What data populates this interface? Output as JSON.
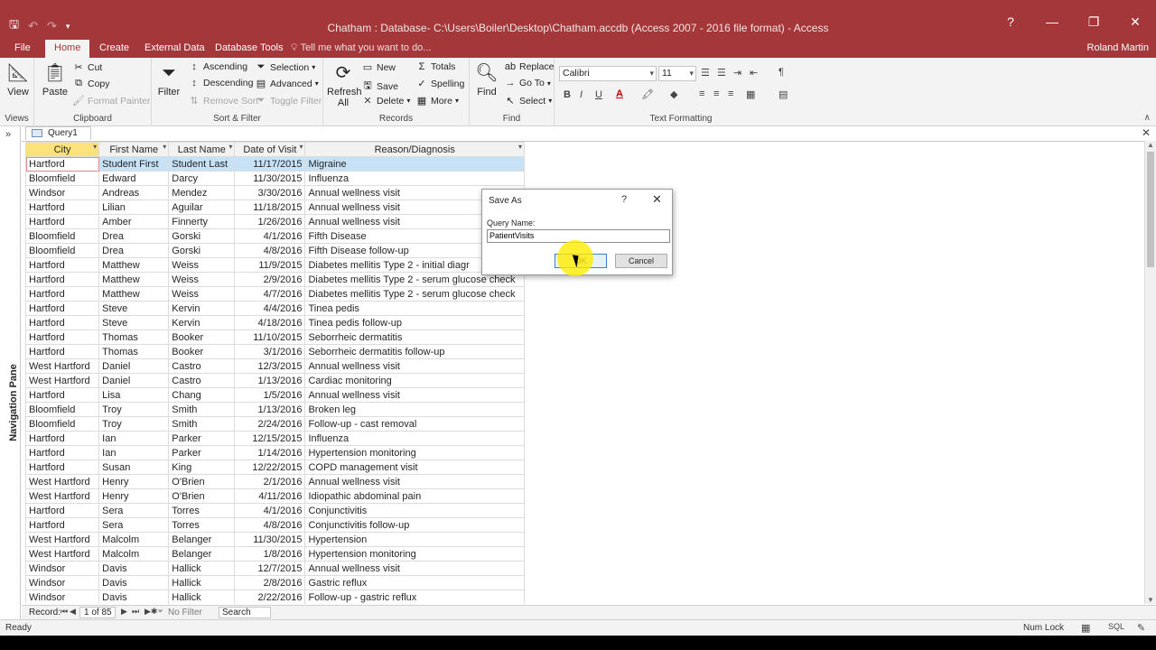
{
  "window": {
    "title": "Chatham : Database- C:\\Users\\Boiler\\Desktop\\Chatham.accdb (Access 2007 - 2016 file format) - Access",
    "user": "Roland Martin",
    "tell_me": "Tell me what you want to do..."
  },
  "tabs": [
    "File",
    "Home",
    "Create",
    "External Data",
    "Database Tools"
  ],
  "ribbon": {
    "views": {
      "view": "View",
      "label": "Views"
    },
    "clipboard": {
      "paste": "Paste",
      "cut": "Cut",
      "copy": "Copy",
      "format_painter": "Format Painter",
      "label": "Clipboard"
    },
    "sort_filter": {
      "filter": "Filter",
      "ascending": "Ascending",
      "descending": "Descending",
      "remove_sort": "Remove Sort",
      "selection": "Selection",
      "advanced": "Advanced",
      "toggle_filter": "Toggle Filter",
      "label": "Sort & Filter"
    },
    "records": {
      "refresh": "Refresh",
      "refresh2": "All",
      "new": "New",
      "save": "Save",
      "delete": "Delete",
      "totals": "Totals",
      "spelling": "Spelling",
      "more": "More",
      "label": "Records"
    },
    "find": {
      "find": "Find",
      "replace": "Replace",
      "goto": "Go To",
      "select": "Select",
      "label": "Find"
    },
    "text_formatting": {
      "font": "Calibri",
      "size": "11",
      "bold": "B",
      "italic": "I",
      "underline": "U",
      "label": "Text Formatting"
    }
  },
  "navigation_pane": {
    "label": "Navigation Pane"
  },
  "document_tab": "Query1",
  "grid": {
    "columns": [
      "City",
      "First Name",
      "Last Name",
      "Date of Visit",
      "Reason/Diagnosis"
    ],
    "rows": [
      [
        "Hartford",
        "Student First",
        "Student Last",
        "11/17/2015",
        "Migraine"
      ],
      [
        "Bloomfield",
        "Edward",
        "Darcy",
        "11/30/2015",
        "Influenza"
      ],
      [
        "Windsor",
        "Andreas",
        "Mendez",
        "3/30/2016",
        "Annual wellness visit"
      ],
      [
        "Hartford",
        "Lilian",
        "Aguilar",
        "11/18/2015",
        "Annual wellness visit"
      ],
      [
        "Hartford",
        "Amber",
        "Finnerty",
        "1/26/2016",
        "Annual wellness visit"
      ],
      [
        "Bloomfield",
        "Drea",
        "Gorski",
        "4/1/2016",
        "Fifth Disease"
      ],
      [
        "Bloomfield",
        "Drea",
        "Gorski",
        "4/8/2016",
        "Fifth Disease follow-up"
      ],
      [
        "Hartford",
        "Matthew",
        "Weiss",
        "11/9/2015",
        "Diabetes mellitis Type 2 - initial diagr"
      ],
      [
        "Hartford",
        "Matthew",
        "Weiss",
        "2/9/2016",
        "Diabetes mellitis Type 2 - serum glucose check"
      ],
      [
        "Hartford",
        "Matthew",
        "Weiss",
        "4/7/2016",
        "Diabetes mellitis Type 2 - serum glucose check"
      ],
      [
        "Hartford",
        "Steve",
        "Kervin",
        "4/4/2016",
        "Tinea pedis"
      ],
      [
        "Hartford",
        "Steve",
        "Kervin",
        "4/18/2016",
        "Tinea pedis follow-up"
      ],
      [
        "Hartford",
        "Thomas",
        "Booker",
        "11/10/2015",
        "Seborrheic dermatitis"
      ],
      [
        "Hartford",
        "Thomas",
        "Booker",
        "3/1/2016",
        "Seborrheic dermatitis follow-up"
      ],
      [
        "West Hartford",
        "Daniel",
        "Castro",
        "12/3/2015",
        "Annual wellness visit"
      ],
      [
        "West Hartford",
        "Daniel",
        "Castro",
        "1/13/2016",
        "Cardiac monitoring"
      ],
      [
        "Hartford",
        "Lisa",
        "Chang",
        "1/5/2016",
        "Annual wellness visit"
      ],
      [
        "Bloomfield",
        "Troy",
        "Smith",
        "1/13/2016",
        "Broken leg"
      ],
      [
        "Bloomfield",
        "Troy",
        "Smith",
        "2/24/2016",
        "Follow-up - cast removal"
      ],
      [
        "Hartford",
        "Ian",
        "Parker",
        "12/15/2015",
        "Influenza"
      ],
      [
        "Hartford",
        "Ian",
        "Parker",
        "1/14/2016",
        "Hypertension monitoring"
      ],
      [
        "Hartford",
        "Susan",
        "King",
        "12/22/2015",
        "COPD management visit"
      ],
      [
        "West Hartford",
        "Henry",
        "O'Brien",
        "2/1/2016",
        "Annual wellness visit"
      ],
      [
        "West Hartford",
        "Henry",
        "O'Brien",
        "4/11/2016",
        "Idiopathic abdominal pain"
      ],
      [
        "Hartford",
        "Sera",
        "Torres",
        "4/1/2016",
        "Conjunctivitis"
      ],
      [
        "Hartford",
        "Sera",
        "Torres",
        "4/8/2016",
        "Conjunctivitis follow-up"
      ],
      [
        "West Hartford",
        "Malcolm",
        "Belanger",
        "11/30/2015",
        "Hypertension"
      ],
      [
        "West Hartford",
        "Malcolm",
        "Belanger",
        "1/8/2016",
        "Hypertension monitoring"
      ],
      [
        "Windsor",
        "Davis",
        "Hallick",
        "12/7/2015",
        "Annual wellness visit"
      ],
      [
        "Windsor",
        "Davis",
        "Hallick",
        "2/8/2016",
        "Gastric reflux"
      ],
      [
        "Windsor",
        "Davis",
        "Hallick",
        "2/22/2016",
        "Follow-up - gastric reflux"
      ]
    ]
  },
  "record_nav": {
    "label": "Record:",
    "position": "1 of 85",
    "no_filter": "No Filter",
    "search": "Search"
  },
  "status": {
    "ready": "Ready",
    "num_lock": "Num Lock"
  },
  "dialog": {
    "title": "Save As",
    "help": "?",
    "close": "✕",
    "query_name_label": "Query Name:",
    "query_name_value": "PatientVisits",
    "ok": "OK",
    "cancel": "Cancel"
  },
  "colors": {
    "accent": "#a4373a",
    "selected_row": "#c7e1f7",
    "selected_header": "#fde27c"
  }
}
